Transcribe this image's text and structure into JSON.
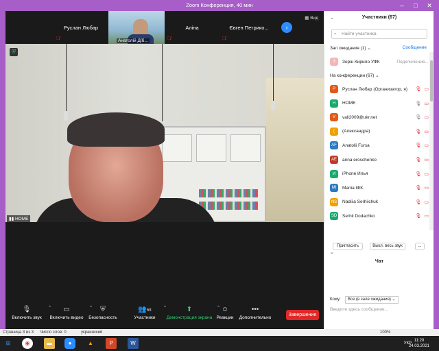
{
  "window": {
    "title": "Zoom Конференция, 40 мин"
  },
  "strip": {
    "tiles": [
      {
        "name": "Руслан Любар"
      },
      {
        "name": "Анатолій Дїб..."
      },
      {
        "name": "Аліна"
      },
      {
        "name": "Євген  Петрико..."
      }
    ],
    "view_label": "Вид"
  },
  "video": {
    "label": "HOME"
  },
  "toolbar": {
    "mute": "Включить звук",
    "video": "Включить видео",
    "security": "Безопасность",
    "participants": "Участники",
    "participants_count": "68",
    "share": "Демонстрация экрана",
    "reactions": "Реакции",
    "more": "Дополнительно",
    "end": "Завершение"
  },
  "panel": {
    "title": "Участники (67)",
    "search_placeholder": "Найти участника",
    "waiting_header": "Зал ожидания (1)",
    "message_link": "Сообщение",
    "waiting": [
      {
        "initial": "З",
        "name": "Зорін Кирило УФК",
        "status": "Подключение...",
        "color": "#f4b6b6"
      }
    ],
    "in_meeting_header": "На конференции (67)",
    "participants": [
      {
        "initial": "Р",
        "name": "Руслан Любар (Организатор, я)",
        "color": "#e05a18",
        "mic": "off"
      },
      {
        "initial": "H",
        "name": "HOME",
        "color": "#1aaa6e",
        "mic": "on"
      },
      {
        "initial": "V",
        "name": "vali2009@ukr.net",
        "color": "#e05a18",
        "mic": "on"
      },
      {
        "initial": "(",
        "name": "(Александра)",
        "color": "#f0a000",
        "mic": "off"
      },
      {
        "initial": "AF",
        "name": "Anatolii Fursa",
        "color": "#2b7bc2",
        "mic": "off"
      },
      {
        "initial": "AE",
        "name": "anna eroschenko",
        "color": "#c0392b",
        "mic": "off"
      },
      {
        "initial": "И",
        "name": "iPhone Илья",
        "color": "#1aaa6e",
        "mic": "off"
      },
      {
        "initial": "MI",
        "name": "Mariia  ІФК.",
        "color": "#2b7bc2",
        "mic": "off"
      },
      {
        "initial": "NS",
        "name": "Nadiiia Serhiichuk",
        "color": "#f0a000",
        "mic": "off"
      },
      {
        "initial": "SD",
        "name": "Serhii Dodachko",
        "color": "#1aaa6e",
        "mic": "off"
      }
    ],
    "invite_btn": "Пригласить",
    "mute_all_btn": "Выкл. весь звук",
    "more_btn": "...",
    "chat_title": "Чат",
    "chat_to_label": "Кому:",
    "chat_to_value": "Все (в зале ожидания)",
    "chat_placeholder": "Введите здесь сообщение..."
  },
  "statusbar": {
    "page": "Страница 3 из 3",
    "words": "Число слов: 0",
    "language": "украинский",
    "zoom": "100%"
  },
  "taskbar": {
    "lang": "УКР",
    "time": "11:20",
    "date": "24.03.2021"
  }
}
